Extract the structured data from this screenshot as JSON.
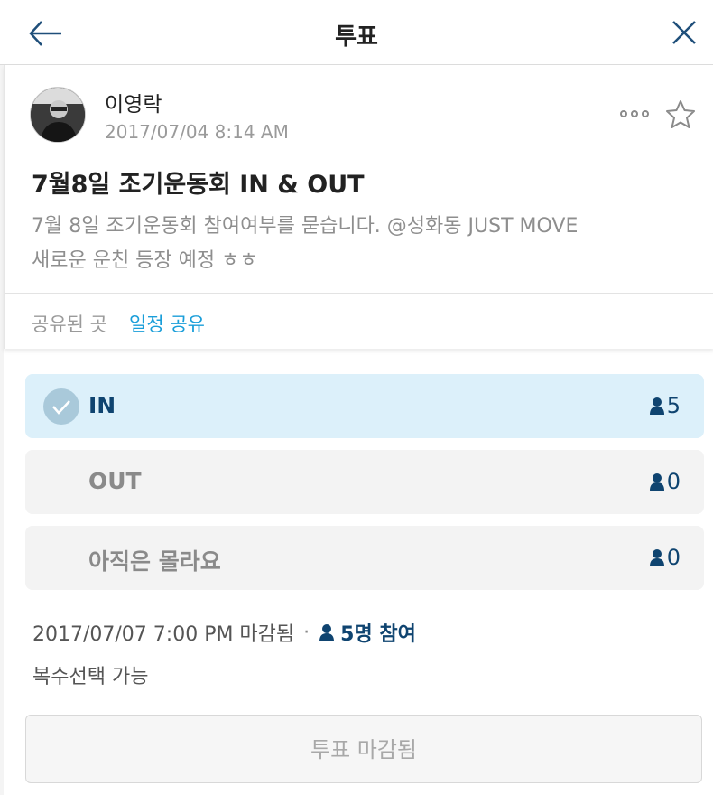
{
  "header": {
    "title": "투표",
    "back_icon": "arrow-left-icon",
    "close_icon": "close-icon"
  },
  "post": {
    "author": "이영락",
    "date": "2017/07/04 8:14 AM",
    "title": "7월8일 조기운동회 IN & OUT",
    "body_line1": "7월 8일 조기운동회 참여여부를 묻습니다. @성화동 JUST MOVE",
    "body_line2": "새로운 운친 등장 예정 ㅎㅎ",
    "share_label": "공유된 곳",
    "share_link": "일정 공유"
  },
  "options": [
    {
      "label": "IN",
      "count": "5",
      "selected": true
    },
    {
      "label": "OUT",
      "count": "0",
      "selected": false
    },
    {
      "label": "아직은 몰라요",
      "count": "0",
      "selected": false
    }
  ],
  "footer": {
    "deadline": "2017/07/07 7:00 PM 마감됨",
    "separator": "·",
    "participants": "5명 참여",
    "multi_select": "복수선택 가능",
    "vote_button": "투표 마감됨"
  },
  "colors": {
    "accent": "#1a9ed9",
    "selected_bg": "#dcf0fa",
    "selected_text": "#0f4470",
    "option_bg": "#f3f3f3"
  }
}
